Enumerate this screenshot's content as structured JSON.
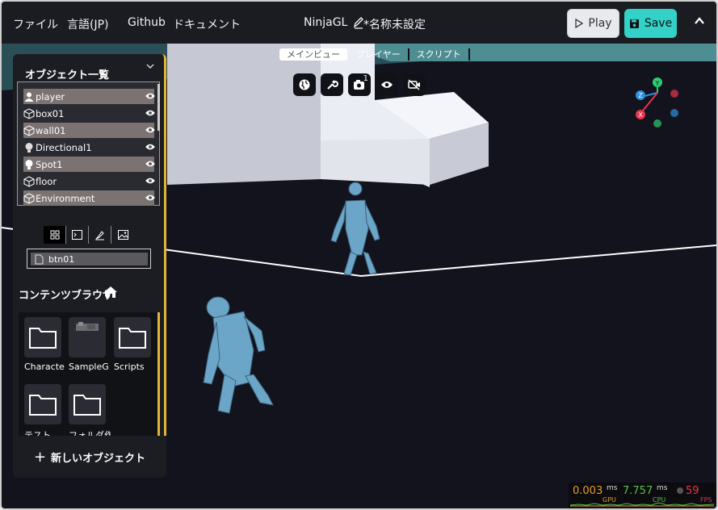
{
  "header": {
    "menu": [
      "ファイル",
      "言語(JP)",
      "Github",
      "ドキュメント"
    ],
    "app_title": "NinjaGL",
    "project_name": "*名称未設定",
    "play_label": "Play",
    "save_label": "Save"
  },
  "viewport": {
    "tabs": [
      "メインビュー",
      "プレイヤー",
      "スクリプト"
    ],
    "active_tab": "メインビュー",
    "tools": [
      "globe-icon",
      "wrench-icon",
      "camera-icon",
      "eye-icon",
      "video-off-icon"
    ],
    "camera_count": "1",
    "gizmo": {
      "y": "Y",
      "z": "Z",
      "x": "X"
    }
  },
  "object_panel": {
    "title": "オブジェクト一覧",
    "objects": [
      {
        "name": "player",
        "icon": "user-icon",
        "selected": true
      },
      {
        "name": "box01",
        "icon": "cube-icon",
        "selected": false
      },
      {
        "name": "wall01",
        "icon": "cube-icon",
        "selected": true
      },
      {
        "name": "Directional1",
        "icon": "bulb-icon",
        "selected": false
      },
      {
        "name": "Spot1",
        "icon": "bulb-icon",
        "selected": true
      },
      {
        "name": "floor",
        "icon": "cube-icon",
        "selected": false
      },
      {
        "name": "Environment",
        "icon": "cube-icon",
        "selected": true
      }
    ]
  },
  "content_browser": {
    "mode_tabs": [
      "grid-icon",
      "terminal-icon",
      "brush-icon",
      "image-icon"
    ],
    "selected_asset": "btn01",
    "title": "コンテンツブラウザ",
    "items": [
      {
        "label": "Characte",
        "kind": "folder"
      },
      {
        "label": "SampleG",
        "kind": "image"
      },
      {
        "label": "Scripts",
        "kind": "folder"
      },
      {
        "label": "テスト",
        "kind": "folder"
      },
      {
        "label": "フォルダ作",
        "kind": "folder"
      }
    ],
    "new_object_label": "新しいオブジェクト"
  },
  "stats": {
    "gpu_ms": "0.003",
    "gpu_unit": "ms",
    "gpu_label": "GPU",
    "cpu_ms": "7.757",
    "cpu_unit": "ms",
    "cpu_label": "CPU",
    "fps": "59",
    "fps_label": "FPS",
    "colors": {
      "gpu": "#e89a2c",
      "cpu": "#58c048",
      "fps": "#e8344c"
    }
  }
}
